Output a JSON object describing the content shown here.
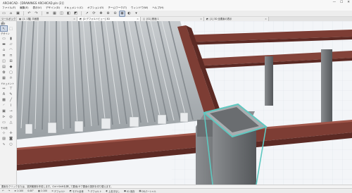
{
  "window": {
    "title": "ARCHICAD - [DRAWINGS ARCHICAD.pln (2)]",
    "minimize": "—",
    "maximize": "☐",
    "close": "✕"
  },
  "menu": [
    "ファイル(F)",
    "編集(E)",
    "表示(V)",
    "デザイン(D)",
    "ドキュメント(C)",
    "オプション(O)",
    "チームワーク(T)",
    "ウィンドウ(W)",
    "ヘルプ(H)"
  ],
  "toolbox": {
    "title": "ツールボックス",
    "select_label": "選択",
    "sections": [
      "デザイン",
      "ドキュメント",
      "その他"
    ]
  },
  "tabs": [
    {
      "label": "[1. 1階] 平面図"
    },
    {
      "label": "[0 デフォルトビュー] 3D"
    },
    {
      "label": "[S1] 断面 1"
    },
    {
      "label": "[1] 3D 全要素の表示"
    }
  ],
  "status": "要素をクリックまたは、選択範囲を作成します。Ctrl+Shiftを押して要素/サブ要素の選択を切り替えます。",
  "infobar": {
    "undo": "↶",
    "redo": "↷",
    "zoom": "1:100",
    "scale": "1:100",
    "defaults": [
      "デフォルト",
      "モデル全体",
      "デフォルト",
      "上書きなし",
      "01 既存",
      "OSパーシャル"
    ],
    "angle": "0.00°"
  },
  "colors": {
    "beam": "#7d3d34",
    "deck": "#8a8f92",
    "column": "#7c7f82",
    "selection": "#5fc8c0",
    "sky": "#f2f4f7"
  }
}
